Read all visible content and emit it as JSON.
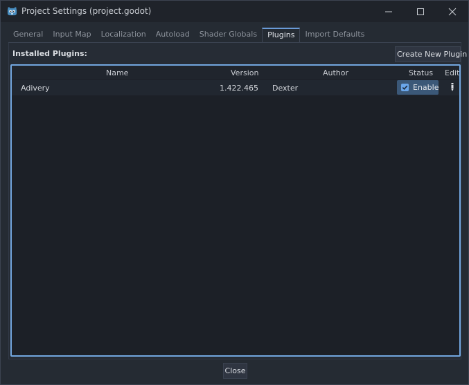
{
  "window": {
    "title": "Project Settings (project.godot)",
    "icons": {
      "app": "godot-logo-icon",
      "minimize": "minimize-icon",
      "maximize": "maximize-icon",
      "close": "close-icon"
    }
  },
  "tabs": [
    {
      "label": "General",
      "active": false
    },
    {
      "label": "Input Map",
      "active": false
    },
    {
      "label": "Localization",
      "active": false
    },
    {
      "label": "Autoload",
      "active": false
    },
    {
      "label": "Shader Globals",
      "active": false
    },
    {
      "label": "Plugins",
      "active": true
    },
    {
      "label": "Import Defaults",
      "active": false
    }
  ],
  "plugins": {
    "installed_label": "Installed Plugins:",
    "create_button": "Create New Plugin",
    "columns": {
      "name": "Name",
      "version": "Version",
      "author": "Author",
      "status": "Status",
      "edit": "Edit"
    },
    "rows": [
      {
        "name": "Adivery",
        "version": "1.422.465",
        "author": "Dexter",
        "status": "Enable",
        "enabled": true,
        "edit_icon": "edit-icon"
      }
    ]
  },
  "footer": {
    "close_button": "Close"
  },
  "colors": {
    "accent": "#73a7e0",
    "checkbox": "#6aa6ea",
    "status_bg": "#3b5878"
  }
}
